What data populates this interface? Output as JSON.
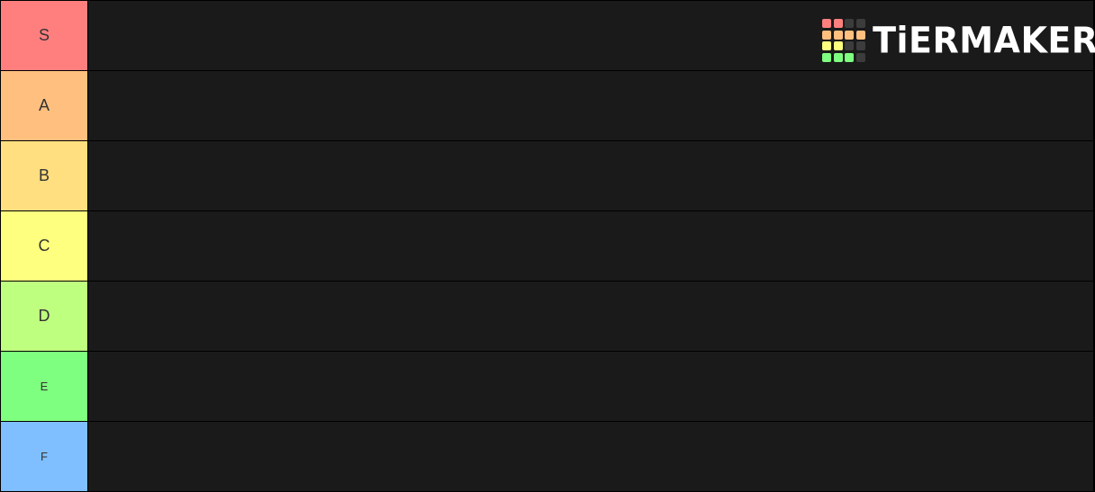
{
  "tiers": [
    {
      "label": "S",
      "color": "#ff7f7f"
    },
    {
      "label": "A",
      "color": "#ffbf7f"
    },
    {
      "label": "B",
      "color": "#ffdf7f"
    },
    {
      "label": "C",
      "color": "#ffff7f"
    },
    {
      "label": "D",
      "color": "#bfff7f"
    },
    {
      "label": "E",
      "color": "#7fff7f"
    },
    {
      "label": "F",
      "color": "#7fbfff"
    }
  ],
  "logo": {
    "text": "TiERMAKER",
    "grid_colors": [
      "#ff7f7f",
      "#ff7f7f",
      "#3c3c3c",
      "#3c3c3c",
      "#ffbf7f",
      "#ffbf7f",
      "#ffbf7f",
      "#ffbf7f",
      "#ffff7f",
      "#ffff7f",
      "#3c3c3c",
      "#3c3c3c",
      "#7fff7f",
      "#7fff7f",
      "#7fff7f",
      "#3c3c3c"
    ]
  }
}
